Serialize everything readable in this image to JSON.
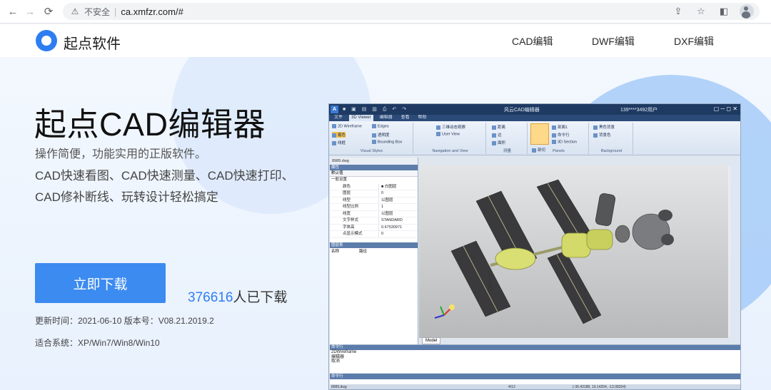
{
  "browser": {
    "insecure_label": "不安全",
    "separator": "|",
    "url": "ca.xmfzr.com/#",
    "back_icon": "arrow-left-icon",
    "forward_icon": "arrow-right-icon",
    "reload_icon": "reload-icon"
  },
  "header": {
    "logo_text": "起点软件",
    "nav": [
      {
        "label": "CAD编辑"
      },
      {
        "label": "DWF编辑"
      },
      {
        "label": "DXF编辑"
      }
    ]
  },
  "hero": {
    "title": "起点CAD编辑器",
    "subtitle": "操作简便，功能实用的正版软件。",
    "line1": "CAD快速看图、CAD快速测量、CAD快速打印、",
    "line2": "CAD修补断线、玩转设计轻松搞定",
    "download_button": "立即下载",
    "download_count": "376616",
    "download_count_suffix": "人已下载",
    "update_info": "更新时间：2021-06-10 版本号：V08.21.2019.2",
    "systems": "适合系统：XP/Win7/Win8/Win10"
  },
  "cad_window": {
    "app_icon": "A",
    "quick_access": "■ ▣ ▤ ▥ ⎙ ↶ ↷",
    "title": "风云CAD编辑器",
    "user": "139****3492用户",
    "win_controls": "▢ ─ ◻ ✕",
    "tabs": [
      "文件",
      "3D Viewer",
      "编辑器",
      "查看",
      "帮助"
    ],
    "ribbon": {
      "visual_styles": {
        "items": [
          "2D Wireframe",
          "Edges",
          "着色",
          "透明度",
          "线框",
          "Bounding Box"
        ],
        "label": "Visual Styles"
      },
      "navigation": {
        "items": [
          "三维动态观察",
          "User View"
        ],
        "label": "Navigation and View"
      },
      "measure": {
        "items": [
          "距离",
          "边",
          "面积"
        ],
        "label": "测量"
      },
      "panels": {
        "items": [
          "剖切",
          "剖面1",
          "命令行",
          "3D Section"
        ],
        "label": "Panels"
      },
      "background": {
        "items": [
          "黑色背景",
          "背景色"
        ],
        "label": "Background"
      }
    },
    "doc_tab": "8989.dwg",
    "props_header": "属性",
    "props_select": "默认值",
    "props_group": "一般设置",
    "props": [
      {
        "k": "颜色",
        "v": "■ 白图层"
      },
      {
        "k": "图层",
        "v": "0"
      },
      {
        "k": "线型",
        "v": "以图层"
      },
      {
        "k": "线型比例",
        "v": "1"
      },
      {
        "k": "线宽",
        "v": "以图层"
      },
      {
        "k": "文字样式",
        "v": "STANDARD"
      },
      {
        "k": "字体高",
        "v": "0.67530971"
      },
      {
        "k": "点显示模式",
        "v": "0"
      }
    ],
    "layers_header": "图层表",
    "layers_cols": [
      "名称",
      "路径"
    ],
    "model_tab": "Model",
    "cmd_header": "命令行",
    "cmd_lines": [
      "2DWireframe",
      "编辑器",
      "取消"
    ],
    "cmd_input_header": "命令行",
    "status_file": "8989.dwg",
    "status_page": "4/12",
    "status_coords": "(-36.43188, 19.14254, -13.08334)"
  },
  "colors": {
    "brand_blue": "#3c8bf0",
    "accent_number": "#2f7df3"
  }
}
